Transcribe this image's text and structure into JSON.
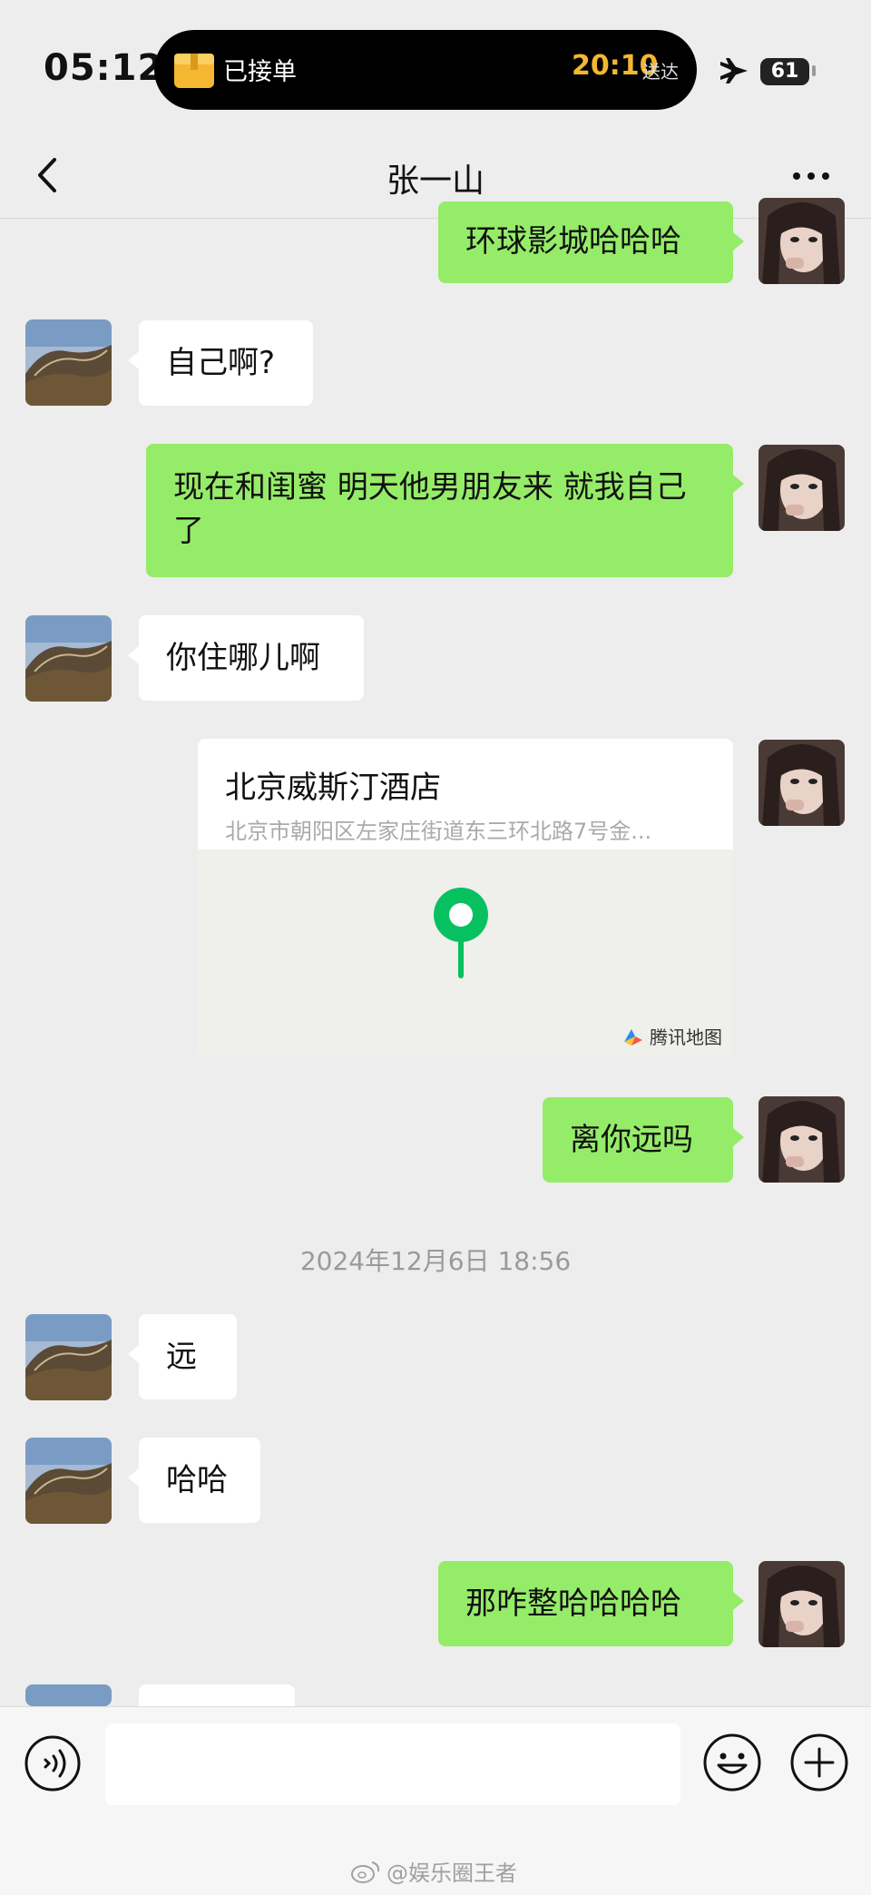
{
  "status_bar": {
    "time": "05:12",
    "live_activity": {
      "text": "已接单",
      "eta": "20:10",
      "eta_label": "送达"
    },
    "battery": "61"
  },
  "nav": {
    "title": "张一山"
  },
  "messages": [
    {
      "side": "out",
      "text": "环球影城哈哈哈"
    },
    {
      "side": "in",
      "text": "自己啊?"
    },
    {
      "side": "out",
      "text": "现在和闺蜜 明天他男朋友来 就我自己了"
    },
    {
      "side": "in",
      "text": "你住哪儿啊"
    },
    {
      "side": "out",
      "type": "location",
      "name": "北京威斯汀酒店",
      "address": "北京市朝阳区左家庄街道东三环北路7号金...",
      "map_brand": "腾讯地图"
    },
    {
      "side": "out",
      "text": "离你远吗"
    },
    {
      "type": "timestamp",
      "text": "2024年12月6日 18:56"
    },
    {
      "side": "in",
      "text": "远"
    },
    {
      "side": "in",
      "text": "哈哈"
    },
    {
      "side": "out",
      "text": "那咋整哈哈哈哈"
    }
  ],
  "input": {
    "value": ""
  },
  "watermark": "@娱乐圈王者",
  "colors": {
    "background": "#ededed",
    "outgoing_bubble": "#95ec69",
    "incoming_bubble": "#ffffff",
    "map_pin": "#07c160"
  },
  "icons": [
    "back-icon",
    "more-icon",
    "box-icon",
    "plane-icon",
    "voice-icon",
    "emoji-icon",
    "plus-icon",
    "map-pin-icon",
    "tencent-map-icon",
    "weibo-icon"
  ]
}
